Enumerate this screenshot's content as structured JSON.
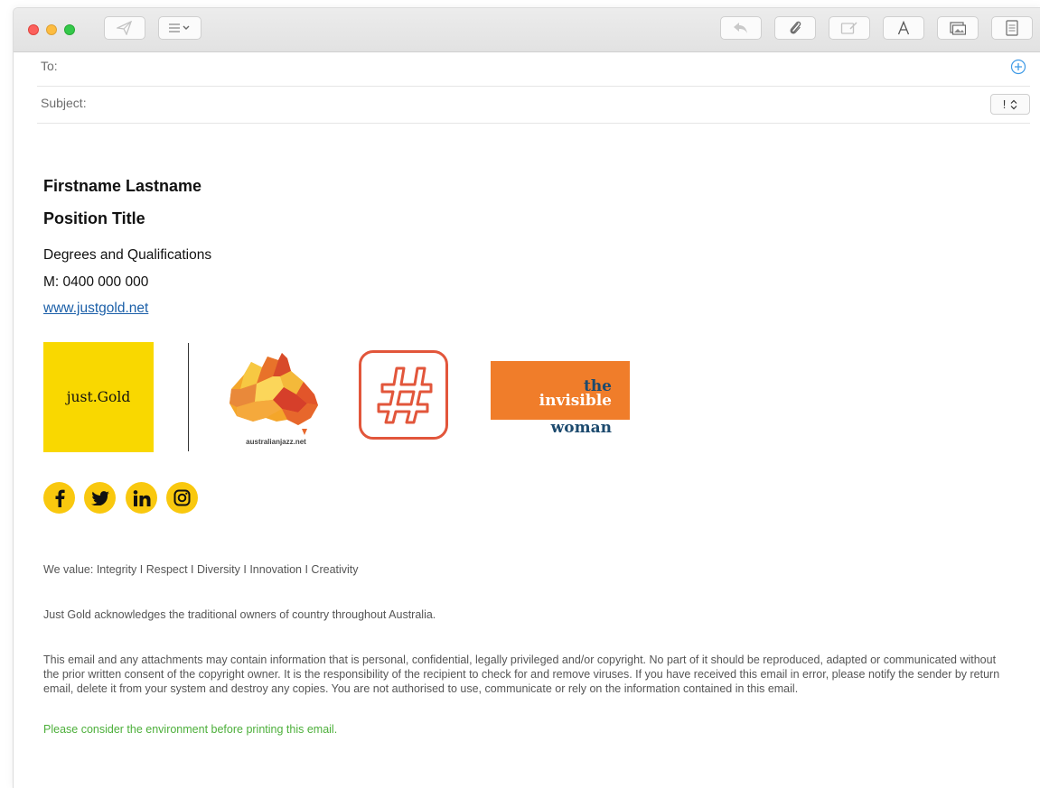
{
  "compose": {
    "to_label": "To:",
    "subject_label": "Subject:",
    "priority_label": "!"
  },
  "signature": {
    "name": "Firstname Lastname",
    "position": "Position Title",
    "degrees": "Degrees and Qualifications",
    "mobile": "M: 0400 000 000",
    "website": "www.justgold.net"
  },
  "logos": {
    "justgold": "just.Gold",
    "ajazz_caption": "australianjazz.net",
    "invisible_woman": [
      "the",
      "invisible",
      "woman"
    ]
  },
  "social_icons": [
    "facebook-icon",
    "twitter-icon",
    "linkedin-icon",
    "instagram-icon"
  ],
  "footer": {
    "values": "We value: Integrity I Respect I Diversity I Innovation I Creativity",
    "acknowledgement": "Just Gold acknowledges the traditional owners of country throughout Australia.",
    "disclaimer": "This email and any attachments may contain information that is personal, confidential, legally privileged and/or copyright. No part of it should be reproduced, adapted or communicated without the prior written consent of the copyright owner. It is the responsibility of the recipient to check for and remove viruses. If you have received this email in error, please notify the sender by return email, delete it from your system and destroy any copies. You are not authorised to use, communicate or rely on the information contained in this email.",
    "environment": "Please consider the environment before printing this email."
  },
  "colors": {
    "brand_yellow": "#f9d800",
    "social_yellow": "#f9c80e",
    "hashtag_orange": "#e2563b",
    "invisible_orange": "#f07d2a",
    "invisible_navy": "#1c4a6e",
    "link_blue": "#1b5fa8",
    "environment_green": "#4caf3a"
  }
}
